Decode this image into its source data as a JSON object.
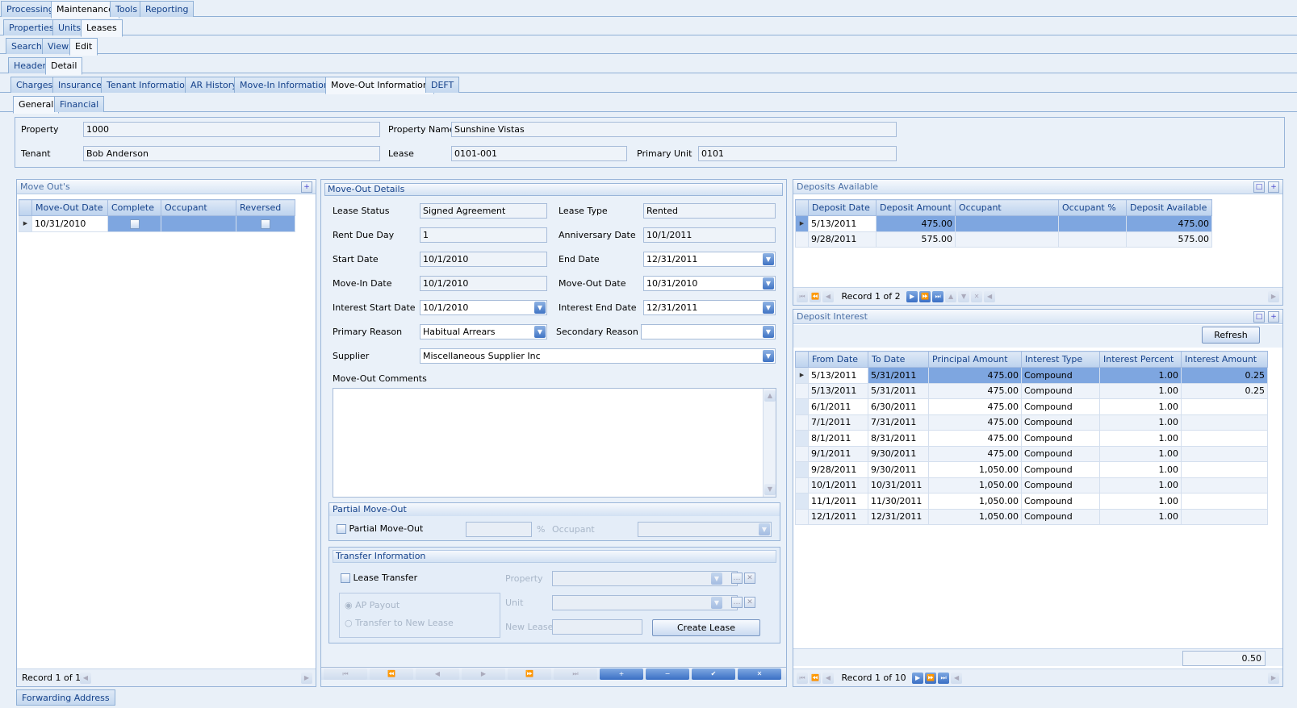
{
  "menu": {
    "tabs": [
      "Processing",
      "Maintenance",
      "Tools",
      "Reporting"
    ]
  },
  "sub1": {
    "tabs": [
      "Properties",
      "Units",
      "Leases"
    ]
  },
  "sub2": {
    "tabs": [
      "Search",
      "View",
      "Edit"
    ]
  },
  "sub3": {
    "tabs": [
      "Header",
      "Detail"
    ]
  },
  "sub4": {
    "tabs": [
      "Charges",
      "Insurance",
      "Tenant Information",
      "AR History",
      "Move-In Information",
      "Move-Out Information",
      "DEFT"
    ]
  },
  "sub5": {
    "tabs": [
      "General",
      "Financial"
    ]
  },
  "info": {
    "property_label": "Property",
    "property": "1000",
    "property_name_label": "Property Name",
    "property_name": "Sunshine Vistas",
    "tenant_label": "Tenant",
    "tenant": "Bob Anderson",
    "lease_label": "Lease",
    "lease": "0101-001",
    "primary_unit_label": "Primary Unit",
    "primary_unit": "0101"
  },
  "moveouts": {
    "title": "Move Out's",
    "columns": [
      "Move-Out Date",
      "Complete",
      "Occupant",
      "Reversed"
    ],
    "rows": [
      {
        "date": "10/31/2010",
        "occupant": ""
      }
    ],
    "record": "Record 1 of 1"
  },
  "details": {
    "title": "Move-Out Details",
    "lease_status_label": "Lease Status",
    "lease_status": "Signed Agreement",
    "lease_type_label": "Lease Type",
    "lease_type": "Rented",
    "rent_due_label": "Rent Due Day",
    "rent_due": "1",
    "anniversary_label": "Anniversary Date",
    "anniversary": "10/1/2011",
    "start_label": "Start Date",
    "start": "10/1/2010",
    "end_label": "End Date",
    "end": "12/31/2011",
    "movein_label": "Move-In Date",
    "movein": "10/1/2010",
    "moveout_label": "Move-Out Date",
    "moveout": "10/31/2010",
    "int_start_label": "Interest Start Date",
    "int_start": "10/1/2010",
    "int_end_label": "Interest End Date",
    "int_end": "12/31/2011",
    "primary_reason_label": "Primary Reason",
    "primary_reason": "Habitual Arrears",
    "secondary_reason_label": "Secondary Reason",
    "secondary_reason": "",
    "supplier_label": "Supplier",
    "supplier": "Miscellaneous Supplier Inc",
    "comments_label": "Move-Out Comments"
  },
  "partial": {
    "title": "Partial Move-Out",
    "check_label": "Partial Move-Out",
    "pct": "%",
    "occupant_label": "Occupant"
  },
  "transfer": {
    "title": "Transfer Information",
    "check_label": "Lease Transfer",
    "property_label": "Property",
    "unit_label": "Unit",
    "new_lease_label": "New Lease",
    "radio1": "AP Payout",
    "radio2": "Transfer to New Lease",
    "create_btn": "Create Lease"
  },
  "deposits": {
    "title": "Deposits Available",
    "columns": [
      "Deposit Date",
      "Deposit Amount",
      "Occupant",
      "Occupant %",
      "Deposit Available"
    ],
    "rows": [
      {
        "date": "5/13/2011",
        "amount": "475.00",
        "occupant": "",
        "pct": "",
        "available": "475.00"
      },
      {
        "date": "9/28/2011",
        "amount": "575.00",
        "occupant": "",
        "pct": "",
        "available": "575.00"
      }
    ],
    "record": "Record 1 of 2"
  },
  "interest": {
    "title": "Deposit Interest",
    "refresh": "Refresh",
    "columns": [
      "From Date",
      "To Date",
      "Principal Amount",
      "Interest Type",
      "Interest Percent",
      "Interest Amount"
    ],
    "rows": [
      {
        "from": "5/13/2011",
        "to": "5/31/2011",
        "principal": "475.00",
        "type": "Compound",
        "pct": "1.00",
        "amount": "0.25"
      },
      {
        "from": "5/13/2011",
        "to": "5/31/2011",
        "principal": "475.00",
        "type": "Compound",
        "pct": "1.00",
        "amount": "0.25"
      },
      {
        "from": "6/1/2011",
        "to": "6/30/2011",
        "principal": "475.00",
        "type": "Compound",
        "pct": "1.00",
        "amount": ""
      },
      {
        "from": "7/1/2011",
        "to": "7/31/2011",
        "principal": "475.00",
        "type": "Compound",
        "pct": "1.00",
        "amount": ""
      },
      {
        "from": "8/1/2011",
        "to": "8/31/2011",
        "principal": "475.00",
        "type": "Compound",
        "pct": "1.00",
        "amount": ""
      },
      {
        "from": "9/1/2011",
        "to": "9/30/2011",
        "principal": "475.00",
        "type": "Compound",
        "pct": "1.00",
        "amount": ""
      },
      {
        "from": "9/28/2011",
        "to": "9/30/2011",
        "principal": "1,050.00",
        "type": "Compound",
        "pct": "1.00",
        "amount": ""
      },
      {
        "from": "10/1/2011",
        "to": "10/31/2011",
        "principal": "1,050.00",
        "type": "Compound",
        "pct": "1.00",
        "amount": ""
      },
      {
        "from": "11/1/2011",
        "to": "11/30/2011",
        "principal": "1,050.00",
        "type": "Compound",
        "pct": "1.00",
        "amount": ""
      },
      {
        "from": "12/1/2011",
        "to": "12/31/2011",
        "principal": "1,050.00",
        "type": "Compound",
        "pct": "1.00",
        "amount": ""
      }
    ],
    "total": "0.50",
    "record": "Record 1 of 10"
  },
  "footer": {
    "forwarding": "Forwarding Address"
  }
}
